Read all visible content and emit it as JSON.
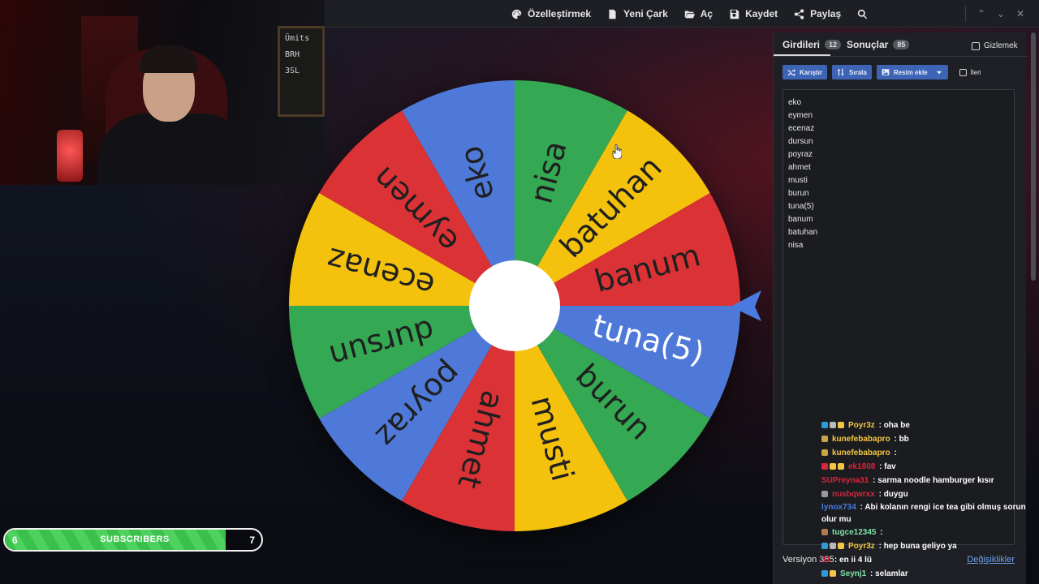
{
  "toolbar": {
    "customize_label": "Özelleştirmek",
    "new_wheel_label": "Yeni Çark",
    "open_label": "Aç",
    "save_label": "Kaydet",
    "share_label": "Paylaş",
    "icons": [
      "palette-icon",
      "file-icon",
      "folder-open-icon",
      "floppy-disk-icon",
      "share-icon",
      "search-icon"
    ]
  },
  "window_controls": {
    "up": "⌃",
    "down": "⌄",
    "close": "✕"
  },
  "webcam": {
    "board_text": [
      "Ümits",
      "BRH",
      "3SL"
    ]
  },
  "wheel": {
    "segments": [
      {
        "label": "eko",
        "color": "#4e79d8"
      },
      {
        "label": "nisa",
        "color": "#34a853"
      },
      {
        "label": "batuhan",
        "color": "#f4c20d"
      },
      {
        "label": "banum",
        "color": "#db3236"
      },
      {
        "label": "tuna(5)",
        "color": "#4e79d8"
      },
      {
        "label": "burun",
        "color": "#34a853"
      },
      {
        "label": "musti",
        "color": "#f4c20d"
      },
      {
        "label": "ahmet",
        "color": "#db3236"
      },
      {
        "label": "poyraz",
        "color": "#4e79d8"
      },
      {
        "label": "dursun",
        "color": "#34a853"
      },
      {
        "label": "ecenaz",
        "color": "#f4c20d"
      },
      {
        "label": "eymen",
        "color": "#db3236"
      }
    ],
    "selected": "tuna(5)",
    "pointer_color": "#4a7be0"
  },
  "panel": {
    "tab_entries": "Girdileri",
    "tab_entries_count": "12",
    "tab_results": "Sonuçlar",
    "tab_results_count": "85",
    "hide_label": "Gizlemek",
    "shuffle_label": "Karıştır",
    "sort_label": "Sırala",
    "add_image_label": "Resim ekle",
    "advanced_label": "İleri",
    "entries": [
      "eko",
      "eymen",
      "ecenaz",
      "dursun",
      "poyraz",
      "ahmet",
      "musti",
      "burun",
      "tuna(5)",
      "banum",
      "batuhan",
      "nisa"
    ],
    "version": "Versiyon 385",
    "changes_label": "Değişiklikler"
  },
  "chat": [
    {
      "user": "Poyr3z",
      "color": "#f5c542",
      "msg": "oha be",
      "badges": [
        "#2e9bd6",
        "#b8b8b8",
        "#f5c542"
      ]
    },
    {
      "user": "kunefebabapro",
      "color": "#f5c542",
      "msg": "bb",
      "badges": [
        "#c9a64a"
      ]
    },
    {
      "user": "kunefebabapro",
      "color": "#f5c542",
      "msg": "",
      "badges": [
        "#c9a64a"
      ]
    },
    {
      "user": "ek1808",
      "color": "#d7263d",
      "msg": "fav",
      "badges": [
        "#d7263d",
        "#f5c542",
        "#f5c542"
      ]
    },
    {
      "user": "SUPreyna31",
      "color": "#d7263d",
      "msg": "sarma noodle hamburger kısır",
      "badges": []
    },
    {
      "user": "nusbqwrxx",
      "color": "#d7263d",
      "msg": "duygu",
      "badges": [
        "#9a9a9a"
      ]
    },
    {
      "user": "lynox734",
      "color": "#4a7be0",
      "msg": "Abi kolanın rengi ice tea gibi olmuş sorun olur mu",
      "badges": []
    },
    {
      "user": "tugce12345",
      "color": "#7fe3a6",
      "msg": "",
      "badges": [
        "#b07a4a"
      ]
    },
    {
      "user": "Poyr3z",
      "color": "#f5c542",
      "msg": "hep buna geliyo ya",
      "badges": [
        "#2e9bd6",
        "#b8b8b8",
        "#f5c542"
      ]
    },
    {
      "user": "31",
      "color": "#d7263d",
      "msg": "en ii 4 lü",
      "badges": []
    },
    {
      "user": "Seynj1",
      "color": "#7fe3a6",
      "msg": "selamlar",
      "badges": [
        "#2e9bd6",
        "#f5c542"
      ]
    }
  ],
  "subscribers": {
    "current": "6",
    "label": "SUBSCRIBERS",
    "goal": "7",
    "progress": 0.86
  }
}
